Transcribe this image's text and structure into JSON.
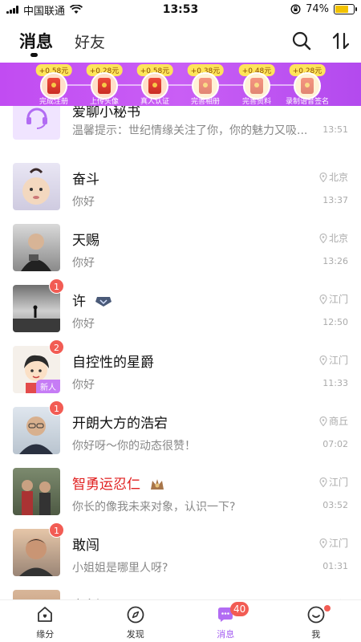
{
  "status_bar": {
    "carrier": "中国联通",
    "time": "13:53",
    "battery": "74%"
  },
  "header": {
    "tabs": [
      {
        "label": "消息"
      },
      {
        "label": "好友"
      }
    ],
    "icons": [
      "search-icon",
      "sort-icon"
    ]
  },
  "task_banner": {
    "tasks": [
      {
        "reward": "+0.58元",
        "label": "完成注册",
        "done": true
      },
      {
        "reward": "+0.28元",
        "label": "上传头像",
        "done": true
      },
      {
        "reward": "+0.58元",
        "label": "真人认证",
        "done": false
      },
      {
        "reward": "+0.38元",
        "label": "完善相册",
        "done": false
      },
      {
        "reward": "+0.48元",
        "label": "完善资料",
        "done": false
      },
      {
        "reward": "+0.28元",
        "label": "录制语音签名",
        "done": false
      }
    ]
  },
  "conversations": [
    {
      "name": "爱聊小秘书",
      "preview": "温馨提示：世纪情缘关注了你，你的魅力又吸...",
      "location": "",
      "time": "13:51",
      "unread": null
    },
    {
      "name": "奋斗",
      "preview": "你好",
      "location": "北京",
      "time": "13:37",
      "unread": null
    },
    {
      "name": "天赐",
      "preview": "你好",
      "location": "北京",
      "time": "13:26",
      "unread": null
    },
    {
      "name": "许",
      "preview": "你好",
      "location": "江门",
      "time": "12:50",
      "unread": "1"
    },
    {
      "name": "自控性的星爵",
      "preview": "你好",
      "location": "江门",
      "time": "11:33",
      "unread": "2",
      "avatar_tag": "新人"
    },
    {
      "name": "开朗大方的浩宕",
      "preview": "你好呀～你的动态很赞！",
      "location": "商丘",
      "time": "07:02",
      "unread": "1"
    },
    {
      "name": "智勇运忍仁",
      "preview": "你长的像我未来对象，认识一下?",
      "location": "江门",
      "time": "03:52",
      "unread": null,
      "name_color": "#e02020"
    },
    {
      "name": "敢闯",
      "preview": "小姐姐是哪里人呀?",
      "location": "江门",
      "time": "01:31",
      "unread": "1"
    },
    {
      "name": "老劉",
      "preview": "",
      "location": "江门",
      "time": "",
      "unread": null
    }
  ],
  "bottom_nav": {
    "items": [
      {
        "label": "缘分",
        "icon": "heart-home-icon"
      },
      {
        "label": "发现",
        "icon": "compass-icon"
      },
      {
        "label": "消息",
        "icon": "chat-bubble-icon",
        "badge": "40"
      },
      {
        "label": "我",
        "icon": "smile-face-icon"
      }
    ]
  },
  "colors": {
    "accent": "#a35bf0",
    "banner": "#c14cf2",
    "badge": "#f25c54"
  }
}
